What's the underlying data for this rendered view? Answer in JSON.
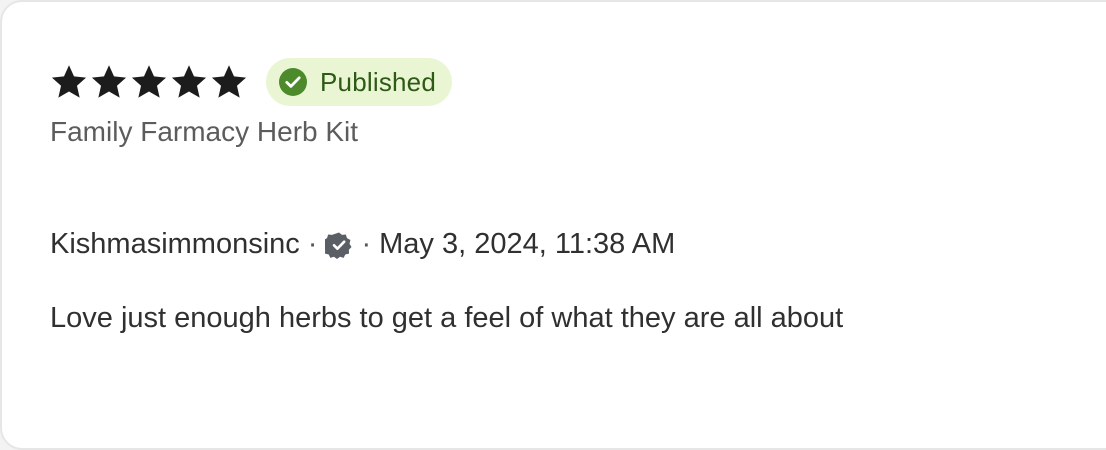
{
  "review": {
    "rating": 5,
    "rating_max": 5,
    "status_label": "Published",
    "product_name": "Family Farmacy Herb Kit",
    "author": "Kishmasimmonsinc",
    "separator": "·",
    "date": "May 3, 2024, 11:38 AM",
    "body": "Love just enough herbs to get a feel of what they are all about"
  },
  "icons": {
    "star": "star-icon",
    "status": "check-circle-icon",
    "verified": "verified-badge-icon"
  },
  "colors": {
    "star": "#1c1c1c",
    "badge_bg": "#eaf6d3",
    "badge_text": "#2f5a16",
    "badge_icon": "#4d8a2b",
    "verified_icon": "#5a5f66",
    "text_primary": "#303030",
    "text_secondary": "#5c5c5c"
  }
}
